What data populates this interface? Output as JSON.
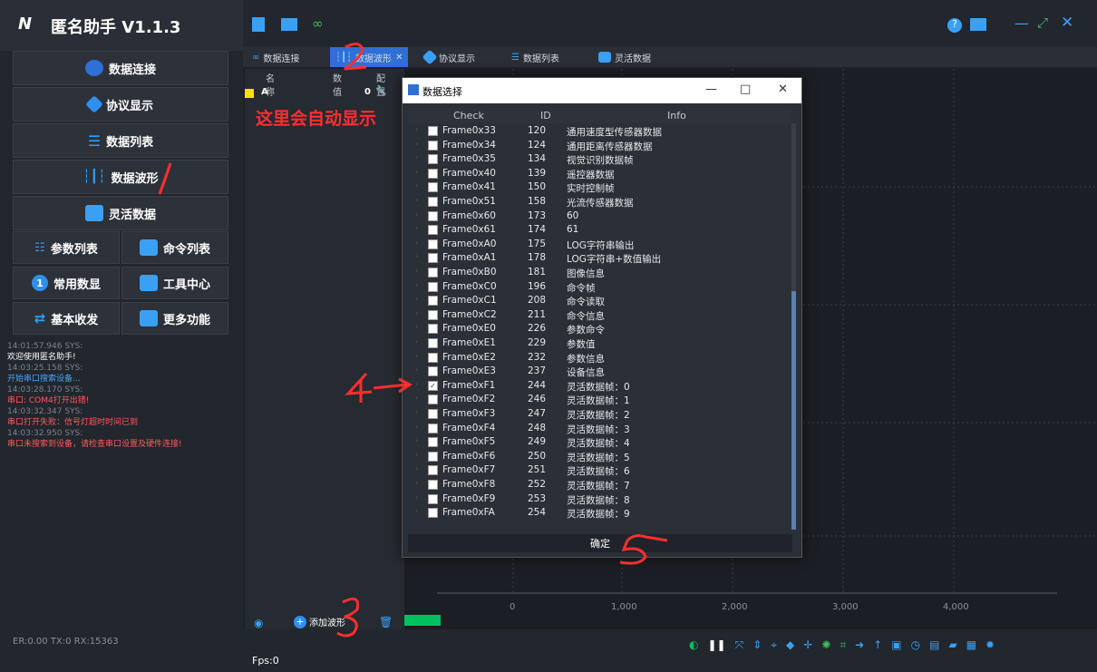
{
  "app": {
    "title": "匿名助手  V1.1.3"
  },
  "left_menu": {
    "data_connect": "数据连接",
    "protocol_display": "协议显示",
    "data_list": "数据列表",
    "data_wave": "数据波形",
    "flex_data": "灵活数据",
    "param_list": "参数列表",
    "cmd_list": "命令列表",
    "common_data": "常用数显",
    "tool_center": "工具中心",
    "basic_rxtx": "基本收发",
    "more_func": "更多功能",
    "common_badge": "1"
  },
  "log": [
    {
      "t": "14:01:57.946 SYS:",
      "msg": "欢迎使用匿名助手!",
      "c": "w"
    },
    {
      "t": "14:03:25.158 SYS:",
      "msg": "开始串口搜索设备...",
      "c": "b"
    },
    {
      "t": "14:03:28.170 SYS:",
      "msg": "串口: COM4打开出错!",
      "c": "r"
    },
    {
      "t": "14:03:32.347 SYS:",
      "msg": "串口打开失败：信号灯超时时间已到",
      "c": "r"
    },
    {
      "t": "14:03:32.950 SYS:",
      "msg": "串口未搜索到设备，请检查串口设置及硬件连接!",
      "c": "r"
    }
  ],
  "status": {
    "left": "ER:0.00 TX:0 RX:15363",
    "fps": "Fps:0"
  },
  "tabs": {
    "connect": "数据连接",
    "wave": "数据波形",
    "protocol": "协议显示",
    "list": "数据列表",
    "flex": "灵活数据"
  },
  "series": {
    "hdr_name": "名称",
    "hdr_value": "数值",
    "hdr_config": "配置",
    "row_name": "A",
    "row_value": "0",
    "add_wave": "添加波形"
  },
  "annotations": {
    "auto_show": "这里会自动显示",
    "n1": "1",
    "n2": "2",
    "n3": "3",
    "n4": "4",
    "n5": "5"
  },
  "dialog": {
    "title": "数据选择",
    "min": "—",
    "max": "□",
    "close": "✕",
    "col_check": "Check",
    "col_id": "ID",
    "col_info": "Info",
    "ok": "确定",
    "rows": [
      {
        "frame": "Frame0x33",
        "id": "120",
        "info": "通用速度型传感器数据",
        "checked": false
      },
      {
        "frame": "Frame0x34",
        "id": "124",
        "info": "通用距离传感器数据",
        "checked": false
      },
      {
        "frame": "Frame0x35",
        "id": "134",
        "info": "视觉识别数据帧",
        "checked": false
      },
      {
        "frame": "Frame0x40",
        "id": "139",
        "info": "遥控器数据",
        "checked": false
      },
      {
        "frame": "Frame0x41",
        "id": "150",
        "info": "实时控制帧",
        "checked": false
      },
      {
        "frame": "Frame0x51",
        "id": "158",
        "info": "光流传感器数据",
        "checked": false
      },
      {
        "frame": "Frame0x60",
        "id": "173",
        "info": "60",
        "checked": false
      },
      {
        "frame": "Frame0x61",
        "id": "174",
        "info": "61",
        "checked": false
      },
      {
        "frame": "Frame0xA0",
        "id": "175",
        "info": "LOG字符串输出",
        "checked": false
      },
      {
        "frame": "Frame0xA1",
        "id": "178",
        "info": "LOG字符串+数值输出",
        "checked": false
      },
      {
        "frame": "Frame0xB0",
        "id": "181",
        "info": "图像信息",
        "checked": false
      },
      {
        "frame": "Frame0xC0",
        "id": "196",
        "info": "命令帧",
        "checked": false
      },
      {
        "frame": "Frame0xC1",
        "id": "208",
        "info": "命令读取",
        "checked": false
      },
      {
        "frame": "Frame0xC2",
        "id": "211",
        "info": "命令信息",
        "checked": false
      },
      {
        "frame": "Frame0xE0",
        "id": "226",
        "info": "参数命令",
        "checked": false
      },
      {
        "frame": "Frame0xE1",
        "id": "229",
        "info": "参数值",
        "checked": false
      },
      {
        "frame": "Frame0xE2",
        "id": "232",
        "info": "参数信息",
        "checked": false
      },
      {
        "frame": "Frame0xE3",
        "id": "237",
        "info": "设备信息",
        "checked": false
      },
      {
        "frame": "Frame0xF1",
        "id": "244",
        "info": "灵活数据帧：0",
        "checked": true
      },
      {
        "frame": "Frame0xF2",
        "id": "246",
        "info": "灵活数据帧：1",
        "checked": false
      },
      {
        "frame": "Frame0xF3",
        "id": "247",
        "info": "灵活数据帧：2",
        "checked": false
      },
      {
        "frame": "Frame0xF4",
        "id": "248",
        "info": "灵活数据帧：3",
        "checked": false
      },
      {
        "frame": "Frame0xF5",
        "id": "249",
        "info": "灵活数据帧：4",
        "checked": false
      },
      {
        "frame": "Frame0xF6",
        "id": "250",
        "info": "灵活数据帧：5",
        "checked": false
      },
      {
        "frame": "Frame0xF7",
        "id": "251",
        "info": "灵活数据帧：6",
        "checked": false
      },
      {
        "frame": "Frame0xF8",
        "id": "252",
        "info": "灵活数据帧：7",
        "checked": false
      },
      {
        "frame": "Frame0xF9",
        "id": "253",
        "info": "灵活数据帧：8",
        "checked": false
      },
      {
        "frame": "Frame0xFA",
        "id": "254",
        "info": "灵活数据帧：9",
        "checked": false
      }
    ]
  },
  "chart_axis": [
    "0",
    "1,000",
    "2,000",
    "3,000",
    "4,000"
  ],
  "colors": {
    "accent": "#2f6fd6",
    "annotation": "#ff2f2f",
    "green": "#00c060"
  }
}
